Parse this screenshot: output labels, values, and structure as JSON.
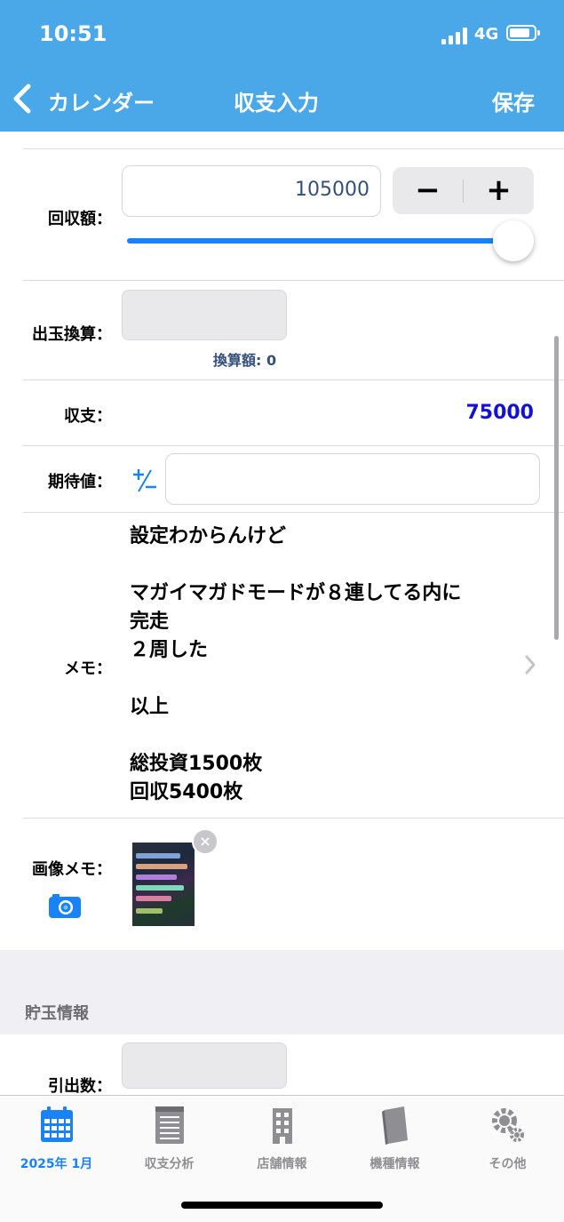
{
  "status_bar": {
    "time": "10:51",
    "network": "4G"
  },
  "nav": {
    "back_label": "カレンダー",
    "title": "収支入力",
    "save_label": "保存"
  },
  "collection": {
    "label": "回収額：",
    "value": "105000",
    "minus": "−",
    "plus": "+",
    "slider_fraction": 1.0
  },
  "conversion": {
    "label": "出玉換算：",
    "value": "",
    "converted_label": "換算額: 0"
  },
  "balance": {
    "label": "収支：",
    "value": "75000"
  },
  "expected": {
    "label": "期待値：",
    "sign_toggle": "+/−",
    "value": ""
  },
  "memo": {
    "label": "メモ：",
    "text": "設定わからんけど\n\nマガイマガドモードが８連してる内に\n完走\n２周した\n\n以上\n\n総投資1500枚\n回収5400枚"
  },
  "image_memo": {
    "label": "画像メモ：",
    "remove": "×"
  },
  "savings": {
    "section_title": "貯玉情報",
    "withdraw_label": "引出数：",
    "withdraw_value": ""
  },
  "tabs": [
    {
      "label": "2025年 1月",
      "icon": "calendar-icon",
      "active": true
    },
    {
      "label": "収支分析",
      "icon": "notepad-icon",
      "active": false
    },
    {
      "label": "店舗情報",
      "icon": "building-icon",
      "active": false
    },
    {
      "label": "機種情報",
      "icon": "book-icon",
      "active": false
    },
    {
      "label": "その他",
      "icon": "gear-icon",
      "active": false
    }
  ],
  "colors": {
    "header": "#4aa8e8",
    "accent": "#1a82f7",
    "balance": "#1212d4",
    "value_text": "#34507a"
  }
}
